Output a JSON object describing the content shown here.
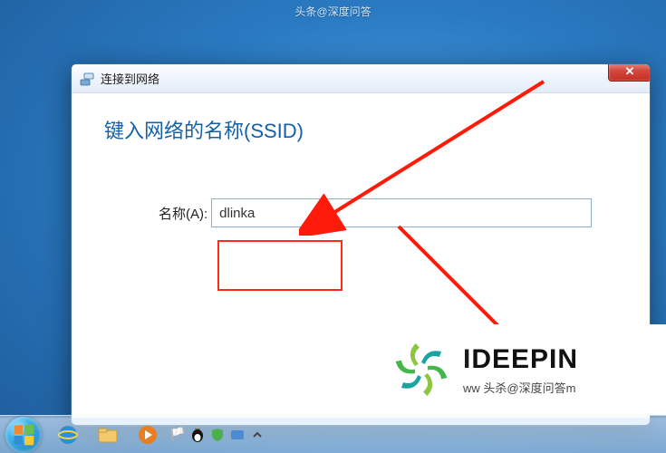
{
  "attribution_top": "头条@深度问答",
  "dialog": {
    "title": "连接到网络",
    "heading": "键入网络的名称(SSID)",
    "field_label": "名称(A):",
    "name_value": "dlinka",
    "close_glyph": "✕"
  },
  "watermark": {
    "brand_left": "I",
    "brand_right": "DEEPIN",
    "subtitle": "ww 头杀@深度问答m"
  },
  "icons": {
    "network": "network-icon",
    "close": "close-icon",
    "start": "start-orb"
  },
  "colors": {
    "accent_blue": "#1560a6",
    "close_red": "#c22f24",
    "highlight_red": "#ff2a1a"
  }
}
